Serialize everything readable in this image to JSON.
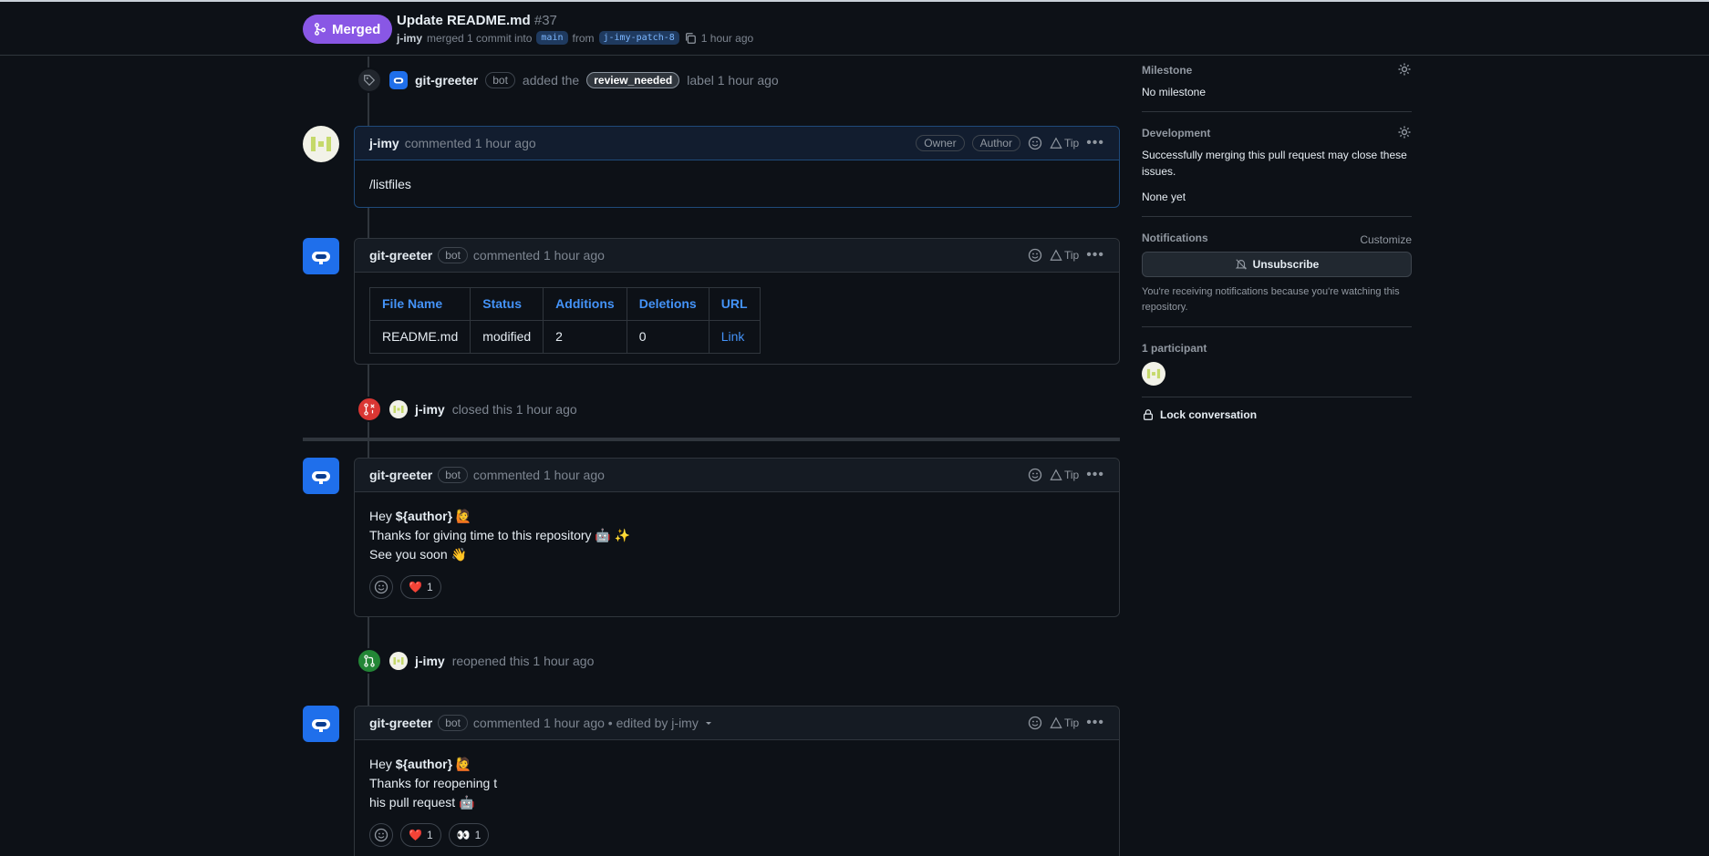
{
  "header": {
    "status": "Merged",
    "title": "Update README.md",
    "number": "#37",
    "author": "j-imy",
    "merge_text": "merged 1 commit into",
    "base_branch": "main",
    "from_text": "from",
    "head_branch": "j-imy-patch-8",
    "time": "1 hour ago"
  },
  "events": {
    "label": {
      "user": "git-greeter",
      "badge": "bot",
      "text_before": "added the",
      "label": "review_needed",
      "text_after": "label 1 hour ago"
    },
    "closed": {
      "user": "j-imy",
      "text": "closed this 1 hour ago"
    },
    "reopened": {
      "user": "j-imy",
      "text": "reopened this 1 hour ago"
    }
  },
  "comments": [
    {
      "user": "j-imy",
      "meta": "commented 1 hour ago",
      "roles": [
        "Owner",
        "Author"
      ],
      "tip": "Tip",
      "body": "/listfiles"
    },
    {
      "user": "git-greeter",
      "badge": "bot",
      "meta": "commented 1 hour ago",
      "tip": "Tip",
      "table": {
        "headers": [
          "File Name",
          "Status",
          "Additions",
          "Deletions",
          "URL"
        ],
        "rows": [
          [
            "README.md",
            "modified",
            "2",
            "0",
            "Link"
          ]
        ]
      }
    },
    {
      "user": "git-greeter",
      "badge": "bot",
      "meta": "commented 1 hour ago",
      "tip": "Tip",
      "lines": [
        {
          "pre": "Hey ",
          "bold": "${author}",
          "post": " 🙋"
        },
        {
          "pre": "Thanks for giving time to this repository 🤖 ✨",
          "bold": "",
          "post": ""
        },
        {
          "pre": "See you soon 👋",
          "bold": "",
          "post": ""
        }
      ],
      "reactions": [
        {
          "emoji": "❤️",
          "count": "1"
        }
      ]
    },
    {
      "user": "git-greeter",
      "badge": "bot",
      "meta": "commented 1 hour ago • edited by j-imy",
      "tip": "Tip",
      "lines": [
        {
          "pre": "Hey ",
          "bold": "${author}",
          "post": " 🙋"
        },
        {
          "pre": "Thanks for reopening t",
          "bold": "",
          "post": ""
        },
        {
          "pre": "his pull request 🤖",
          "bold": "",
          "post": ""
        }
      ],
      "reactions": [
        {
          "emoji": "❤️",
          "count": "1"
        },
        {
          "emoji": "👀",
          "count": "1"
        }
      ]
    }
  ],
  "sidebar": {
    "milestone": {
      "title": "Milestone",
      "value": "No milestone"
    },
    "development": {
      "title": "Development",
      "text": "Successfully merging this pull request may close these issues.",
      "value": "None yet"
    },
    "notifications": {
      "title": "Notifications",
      "customize": "Customize",
      "button": "Unsubscribe",
      "note": "You're receiving notifications because you're watching this repository."
    },
    "participants": {
      "title": "1 participant"
    },
    "lock": "Lock conversation"
  },
  "colors": {
    "merged": "#8957e5",
    "closed": "#da3633",
    "reopened": "#238636",
    "link": "#4493f8",
    "bot_avatar": "#1f6feb"
  }
}
